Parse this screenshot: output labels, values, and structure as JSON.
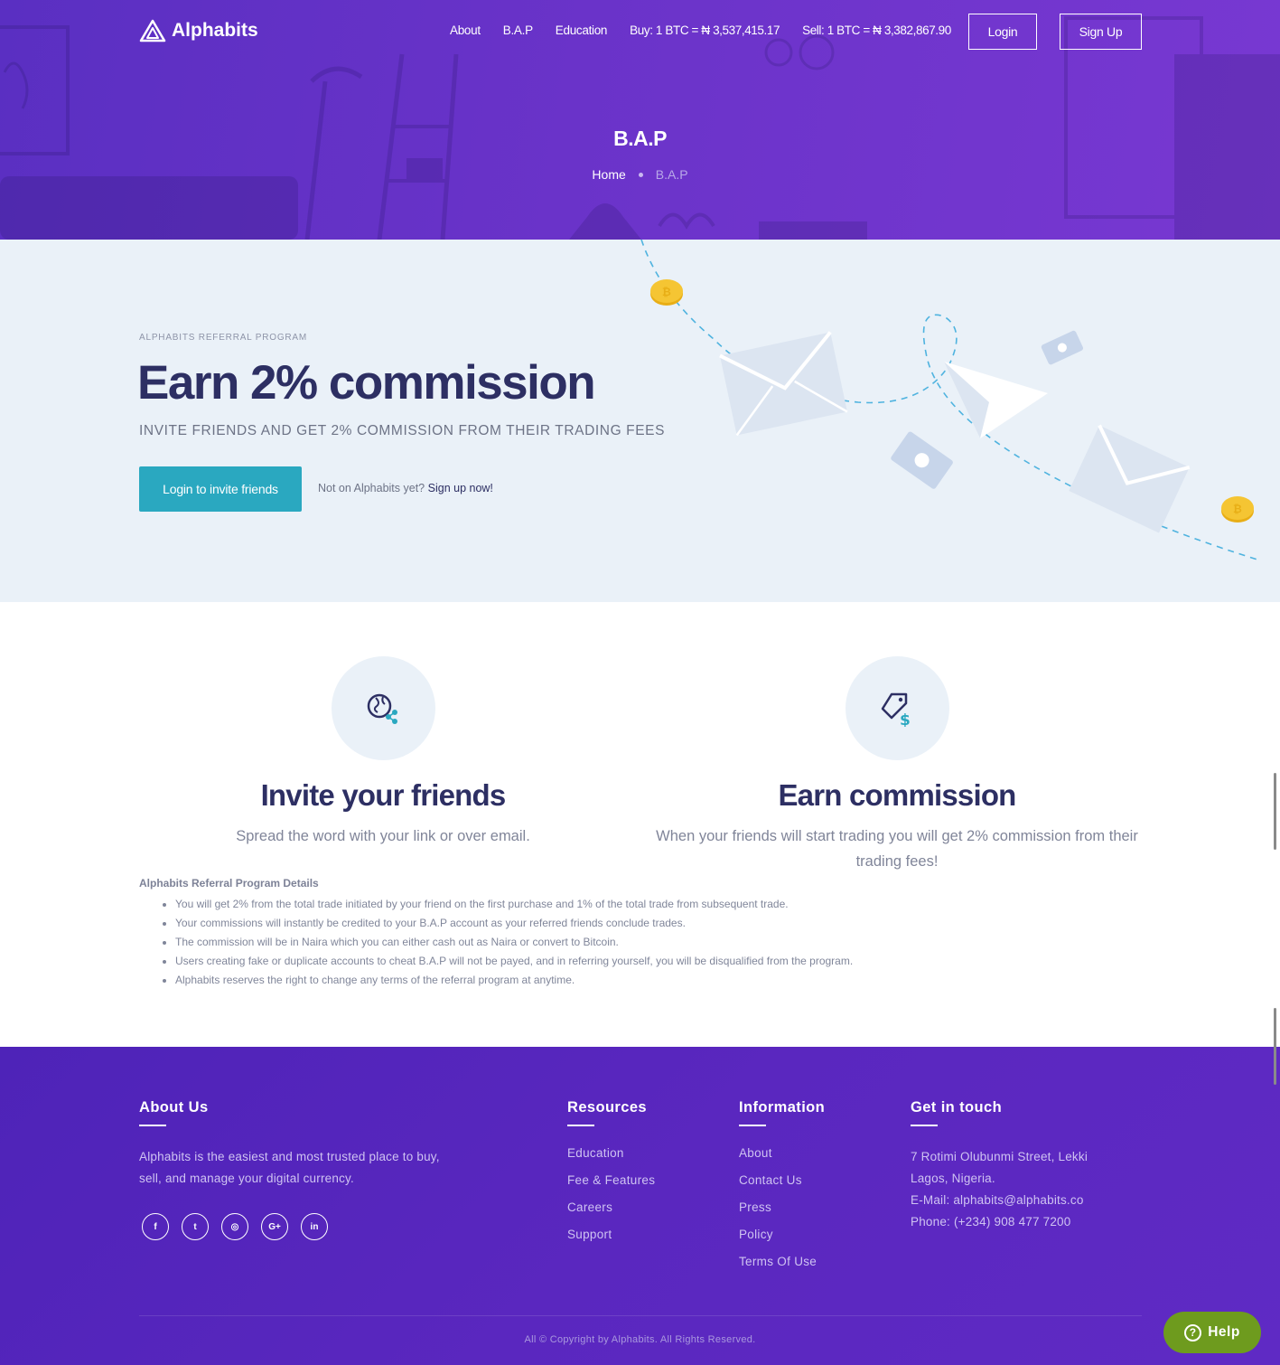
{
  "header": {
    "logo_text": "Alphabits",
    "nav": [
      "About",
      "B.A.P",
      "Education"
    ],
    "buy_rate": "Buy: 1 BTC = ₦ 3,537,415.17",
    "sell_rate": "Sell: 1 BTC = ₦ 3,382,867.90",
    "login_label": "Login",
    "signup_label": "Sign Up"
  },
  "hero": {
    "title": "B.A.P",
    "breadcrumb_home": "Home",
    "breadcrumb_current": "B.A.P"
  },
  "referral": {
    "eyebrow": "ALPHABITS REFERRAL PROGRAM",
    "headline": "Earn 2% commission",
    "subheadline": "INVITE FRIENDS AND GET 2% COMMISSION FROM THEIR TRADING FEES",
    "cta_label": "Login to invite friends",
    "note_text": "Not on Alphabits yet?",
    "note_link": "Sign up now!"
  },
  "features": [
    {
      "title": "Invite your friends",
      "desc": "Spread the word with your link or over email.",
      "icon": "share-globe-icon"
    },
    {
      "title": "Earn commission",
      "desc": "When your friends will start trading you will get 2% commission from their trading fees!",
      "icon": "price-tag-dollar-icon"
    }
  ],
  "details": {
    "title": "Alphabits Referral Program Details",
    "items": [
      "You will get 2% from the total trade initiated by your friend on the first purchase and 1% of the total trade from subsequent trade.",
      "Your commissions will instantly be credited to your B.A.P account as your referred friends conclude trades.",
      "The commission will be in Naira which you can either cash out as Naira or convert to Bitcoin.",
      "Users creating fake or duplicate accounts to cheat B.A.P will not be payed, and in referring yourself, you will be disqualified from the program.",
      "Alphabits reserves the right to change any terms of the referral program at anytime."
    ]
  },
  "footer": {
    "about_title": "About Us",
    "about_text": "Alphabits is the easiest and most trusted place to buy, sell, and manage your digital currency.",
    "socials": [
      "facebook-icon",
      "twitter-icon",
      "instagram-icon",
      "google-plus-icon",
      "linkedin-icon"
    ],
    "social_glyphs": [
      "f",
      "t",
      "◎",
      "G+",
      "in"
    ],
    "resources_title": "Resources",
    "resources": [
      "Education",
      "Fee & Features",
      "Careers",
      "Support"
    ],
    "information_title": "Information",
    "information": [
      "About",
      "Contact Us",
      "Press",
      "Policy",
      "Terms Of Use"
    ],
    "contact_title": "Get in touch",
    "contact_address1": "7 Rotimi Olubunmi Street, Lekki",
    "contact_address2": "Lagos, Nigeria.",
    "contact_email": "E-Mail: alphabits@alphabits.co",
    "contact_phone": "Phone: (+234) 908 477 7200",
    "copyright": "All © Copyright by Alphabits. All Rights Reserved."
  },
  "help_label": "Help",
  "colors": {
    "primary_purple": "#5a2fc2",
    "accent_teal": "#2aa8c0",
    "heading_navy": "#2d2f63",
    "help_green": "#6e9b1e"
  }
}
